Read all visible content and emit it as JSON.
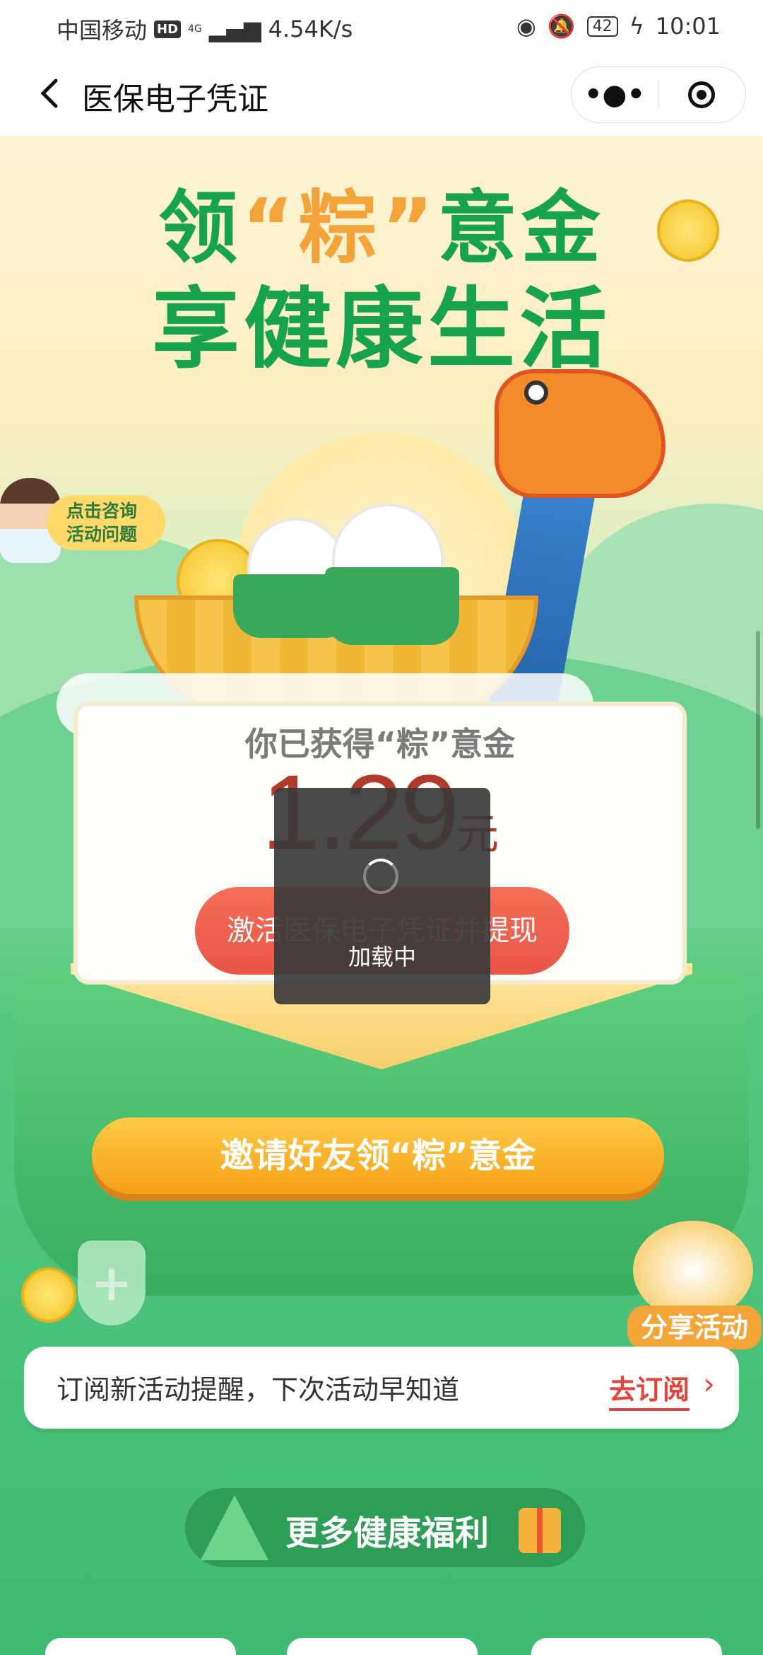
{
  "status_bar": {
    "carrier": "中国移动",
    "hd": "HD",
    "network": "4G",
    "speed": "4.54K/s",
    "battery": "42",
    "time": "10:01"
  },
  "nav": {
    "title": "医保电子凭证",
    "back_icon": "chevron-left-icon",
    "more_icon": "more-dots-icon",
    "close_icon": "target-icon"
  },
  "banner": {
    "line1_prefix": "领",
    "line1_quote": "“粽”",
    "line1_suffix": "意金",
    "line2": "享健康生活"
  },
  "consult": {
    "text_line1": "点击咨询",
    "text_line2": "活动问题"
  },
  "card": {
    "title": "你已获得“粽”意金",
    "amount": "1.29",
    "unit": "元",
    "action_label": "激活医保电子凭证并提现"
  },
  "invite_button": "邀请好友领“粽”意金",
  "share_button": "分享活动",
  "subscribe": {
    "text": "订阅新活动提醒，下次活动早知道",
    "action": "去订阅",
    "chevron": "›"
  },
  "more_section": {
    "label": "更多健康福利"
  },
  "loading": {
    "text": "加载中"
  },
  "colors": {
    "primary_green": "#17a34e",
    "accent_orange": "#f59f16",
    "red_button": "#e85447",
    "amount_red": "#b23a2b"
  }
}
